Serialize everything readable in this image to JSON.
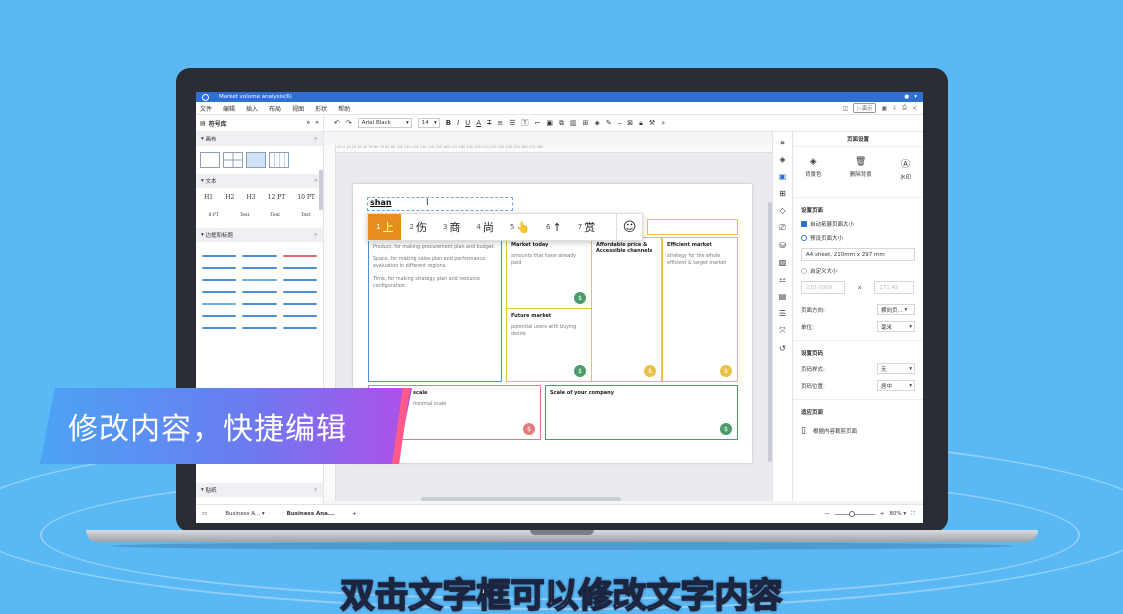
{
  "app": {
    "window_title": "Market volume analysis(6)",
    "menu": [
      "文件",
      "编辑",
      "插入",
      "布局",
      "视图",
      "形状",
      "帮助"
    ],
    "present_label": "演示"
  },
  "left_panel": {
    "title": "符号库",
    "sections": {
      "canvas": "画布",
      "text": "文本",
      "borders": "边框和标题",
      "stickers": "贴纸"
    },
    "text_samples": [
      "H1",
      "H2",
      "H3",
      "12 PT",
      "10 PT"
    ],
    "text_samples_row2": [
      "8 PT",
      "Text",
      "Text",
      "Text"
    ]
  },
  "toolbar": {
    "font": "Arial Black",
    "size": "14"
  },
  "ruler_text": "-10  0  10  20  30  40  50  60  70  80  90  100  110  120  130  140  150  160  170  180  190  200  210  220  230  240  250  260  270  280",
  "canvas": {
    "typed_text": "shan",
    "ime_candidates": [
      {
        "num": "1",
        "text": "上"
      },
      {
        "num": "2",
        "text": "伤"
      },
      {
        "num": "3",
        "text": "商"
      },
      {
        "num": "4",
        "text": "尚"
      },
      {
        "num": "5",
        "text": "👆"
      },
      {
        "num": "6",
        "text": "↑"
      },
      {
        "num": "7",
        "text": "赏"
      }
    ],
    "ime_emoji": "☺",
    "cards": {
      "left_body": [
        "Product, for making procurement plan and budget.",
        "Space, for making sales plan and performance evaluation in different regions.",
        "Time, for making strategy plan and resource configuration."
      ],
      "market_today_title": "Market today",
      "market_today_body": "amounts that have already paid",
      "affordable_title": "Affordable price & Accessible channels",
      "efficient_title": "Efficient market",
      "efficient_body": "strategy for the whole efficient & target market",
      "future_title": "Future market",
      "future_body": "potential users with buying desire",
      "scale_title": "scale",
      "scale_body": "minimal scale",
      "company_title": "Scale of your company"
    },
    "colors": {
      "blue": "#4f8ed8",
      "yellow": "#e8c14a",
      "green": "#4b9b6e",
      "red": "#e07d7d",
      "ime_active": "#e58e1f"
    }
  },
  "right_panel": {
    "title": "页面设置",
    "buttons": [
      "背景色",
      "删除背景",
      "水印"
    ],
    "page_setup_heading": "设置页面",
    "auto_expand": "自动拓展页面大小",
    "preset_size": "预设页面大小",
    "preset_value": "A4 sheet, 210mm x 297 mm",
    "custom_size": "自定义大小",
    "width_value": "210.0000",
    "height_value": "171.45",
    "times": "x",
    "orientation_label": "页面方向:",
    "orientation_value": "横向页...",
    "unit_label": "单位:",
    "unit_value": "毫米",
    "page_number_heading": "设置页码",
    "page_number_style_label": "页码样式:",
    "page_number_style_value": "无",
    "page_number_pos_label": "页码位置:",
    "page_number_pos_value": "居中",
    "fit_page_heading": "适应页面",
    "fit_content": "根据内容裁剪页面"
  },
  "status": {
    "tabs": [
      "Business A...",
      "Business Ana..."
    ],
    "add": "+",
    "zoom": "80%"
  },
  "overlay": {
    "banner": "修改内容，快捷编辑",
    "subtitle": "双击文字框可以修改文字内容"
  }
}
